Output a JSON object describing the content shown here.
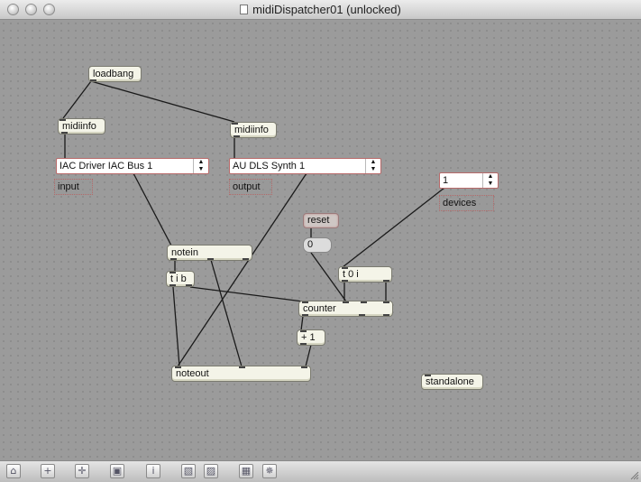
{
  "window": {
    "title": "midiDispatcher01 (unlocked)"
  },
  "titlebar_buttons": [
    "close",
    "minimize",
    "zoom"
  ],
  "patch": {
    "loadbang": "loadbang",
    "midiinfo_left": "midiinfo",
    "midiinfo_right": "midiinfo",
    "umenu_input": {
      "value": "IAC Driver IAC Bus 1"
    },
    "umenu_output": {
      "value": "AU DLS Synth 1"
    },
    "umenu_devices": {
      "value": "1"
    },
    "comment_input": "input",
    "comment_output": "output",
    "comment_devices": "devices",
    "reset_message": "reset",
    "number_box": "0",
    "notein": "notein",
    "tib": "t i b",
    "t0i": "t 0 i",
    "counter": "counter",
    "plus1": "+ 1",
    "noteout": "noteout",
    "standalone": "standalone"
  },
  "toolbar": {
    "items": [
      {
        "name": "lock-icon",
        "glyph": "⌂"
      },
      {
        "name": "new-object-icon",
        "glyph": "+"
      },
      {
        "name": "move-icon",
        "glyph": "✛"
      },
      {
        "name": "presentation-icon",
        "glyph": "▣"
      },
      {
        "name": "inspector-icon",
        "glyph": "i"
      },
      {
        "name": "arrange-front-icon",
        "glyph": "▧"
      },
      {
        "name": "arrange-back-icon",
        "glyph": "▨"
      },
      {
        "name": "grid-icon",
        "glyph": "▦"
      },
      {
        "name": "settings-icon",
        "glyph": "✵"
      }
    ]
  },
  "colors": {
    "canvas": "#9b9b9b",
    "object_fill": "#f4f4e8",
    "umenu_border": "#b86a6a",
    "cord": "#1a1a1a"
  }
}
